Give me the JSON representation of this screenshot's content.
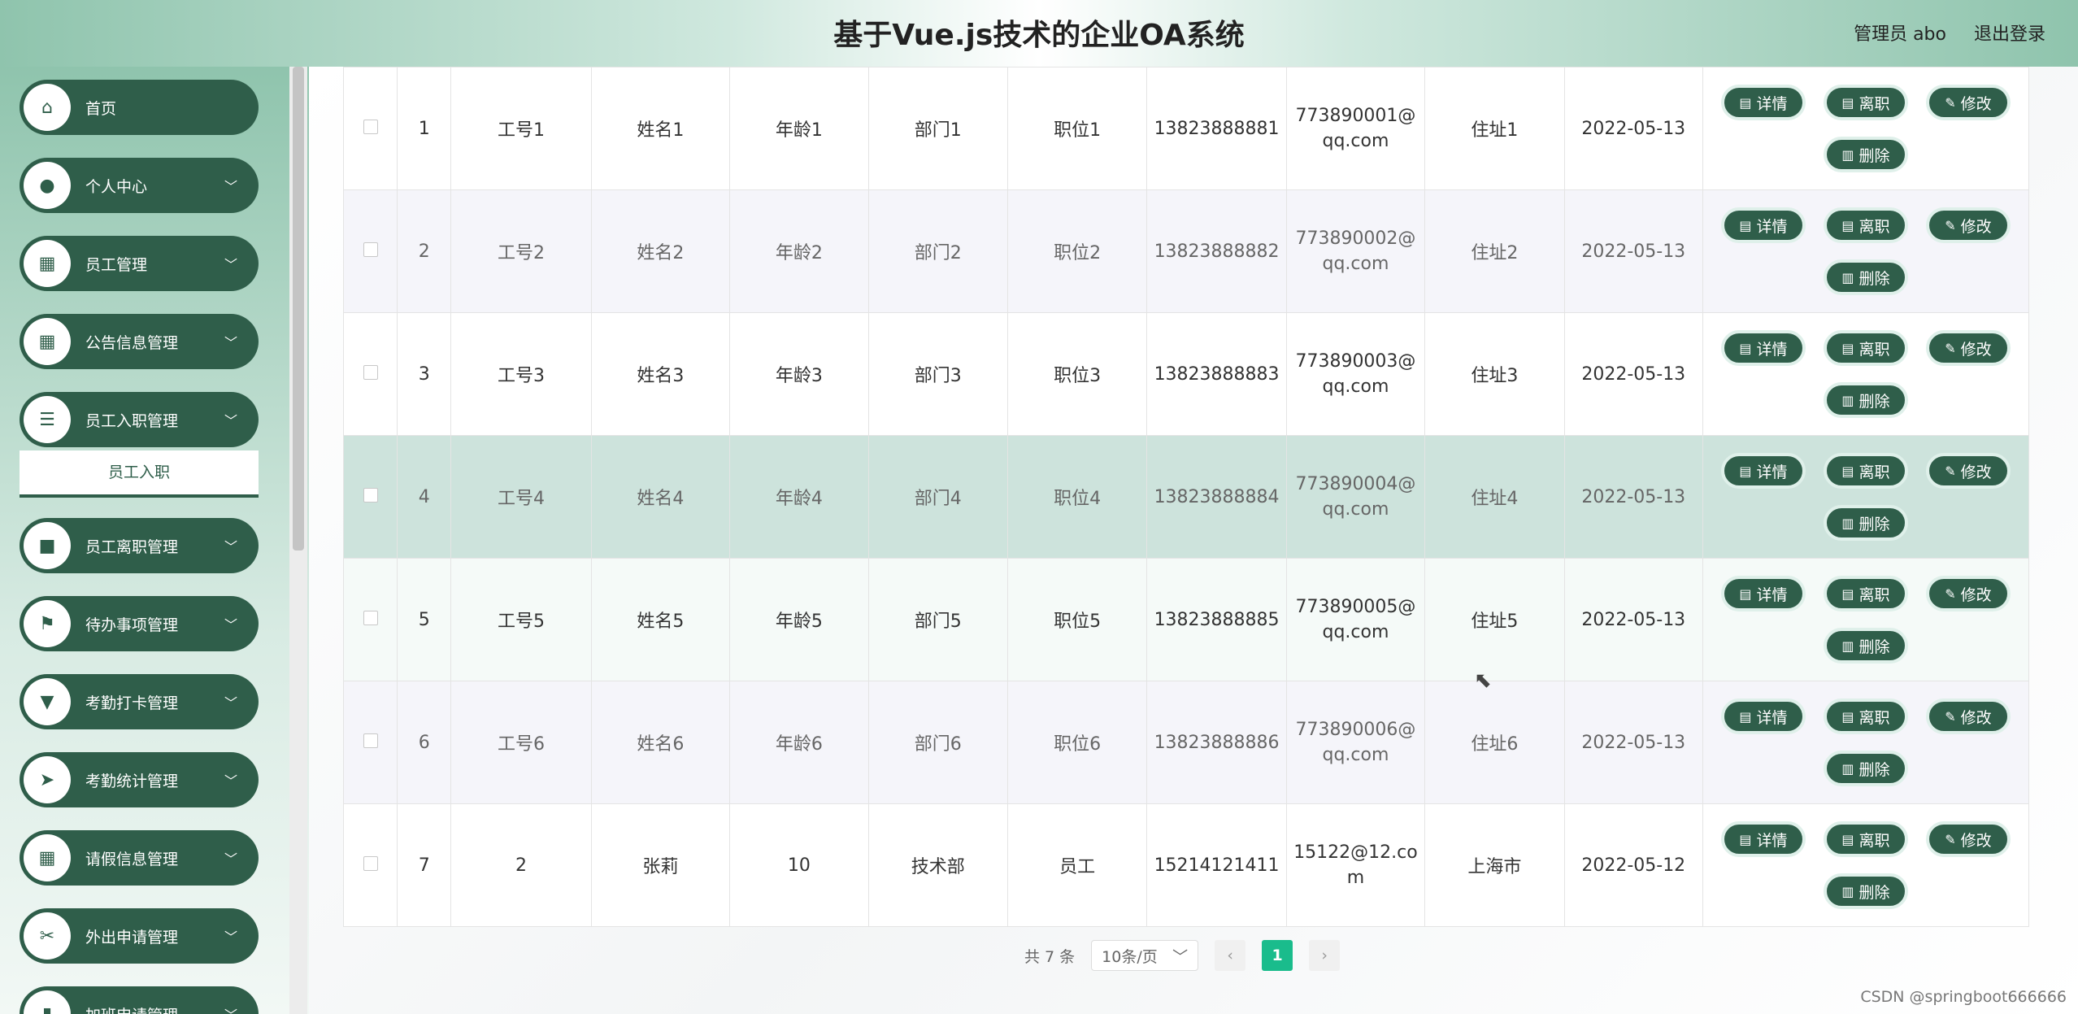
{
  "header": {
    "title": "基于Vue.js技术的企业OA系统",
    "user": "管理员 abo",
    "logout": "退出登录"
  },
  "sidebar": {
    "items": [
      {
        "label": "首页",
        "icon": "home-icon"
      },
      {
        "label": "个人中心",
        "icon": "user-icon"
      },
      {
        "label": "员工管理",
        "icon": "grid-icon"
      },
      {
        "label": "公告信息管理",
        "icon": "grid-icon"
      },
      {
        "label": "员工入职管理",
        "icon": "sliders-icon"
      },
      {
        "label": "员工离职管理",
        "icon": "briefcase-icon"
      },
      {
        "label": "待办事项管理",
        "icon": "flag-icon"
      },
      {
        "label": "考勤打卡管理",
        "icon": "stamp-icon"
      },
      {
        "label": "考勤统计管理",
        "icon": "send-icon"
      },
      {
        "label": "请假信息管理",
        "icon": "grid-icon"
      },
      {
        "label": "外出申请管理",
        "icon": "ticket-icon"
      },
      {
        "label": "加班申请管理",
        "icon": "chart-icon"
      }
    ],
    "submenu": "员工入职"
  },
  "table": {
    "rows": [
      {
        "idx": "1",
        "no": "工号1",
        "name": "姓名1",
        "age": "年龄1",
        "dept": "部门1",
        "pos": "职位1",
        "phone": "13823888881",
        "email1": "773890001@",
        "email2": "qq.com",
        "addr": "住址1",
        "date": "2022-05-13"
      },
      {
        "idx": "2",
        "no": "工号2",
        "name": "姓名2",
        "age": "年龄2",
        "dept": "部门2",
        "pos": "职位2",
        "phone": "13823888882",
        "email1": "773890002@",
        "email2": "qq.com",
        "addr": "住址2",
        "date": "2022-05-13"
      },
      {
        "idx": "3",
        "no": "工号3",
        "name": "姓名3",
        "age": "年龄3",
        "dept": "部门3",
        "pos": "职位3",
        "phone": "13823888883",
        "email1": "773890003@",
        "email2": "qq.com",
        "addr": "住址3",
        "date": "2022-05-13"
      },
      {
        "idx": "4",
        "no": "工号4",
        "name": "姓名4",
        "age": "年龄4",
        "dept": "部门4",
        "pos": "职位4",
        "phone": "13823888884",
        "email1": "773890004@",
        "email2": "qq.com",
        "addr": "住址4",
        "date": "2022-05-13"
      },
      {
        "idx": "5",
        "no": "工号5",
        "name": "姓名5",
        "age": "年龄5",
        "dept": "部门5",
        "pos": "职位5",
        "phone": "13823888885",
        "email1": "773890005@",
        "email2": "qq.com",
        "addr": "住址5",
        "date": "2022-05-13"
      },
      {
        "idx": "6",
        "no": "工号6",
        "name": "姓名6",
        "age": "年龄6",
        "dept": "部门6",
        "pos": "职位6",
        "phone": "13823888886",
        "email1": "773890006@",
        "email2": "qq.com",
        "addr": "住址6",
        "date": "2022-05-13"
      },
      {
        "idx": "7",
        "no": "2",
        "name": "张莉",
        "age": "10",
        "dept": "技术部",
        "pos": "员工",
        "phone": "15214121411",
        "email1": "15122@12.co",
        "email2": "m",
        "addr": "上海市",
        "date": "2022-05-12"
      }
    ],
    "actions": {
      "detail": "详情",
      "leave": "离职",
      "edit": "修改",
      "delete": "删除"
    }
  },
  "pagination": {
    "total": "共 7 条",
    "page_size": "10条/页",
    "current": "1"
  },
  "watermark": "CSDN @springboot666666",
  "colors": {
    "primary": "#2f5e4a",
    "accent": "#1abc8c"
  }
}
